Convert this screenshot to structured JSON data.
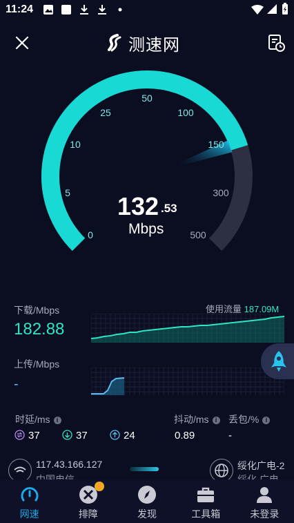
{
  "status_bar": {
    "time": "11:24"
  },
  "header": {
    "brand": "测速网"
  },
  "gauge": {
    "scale_labels": [
      "0",
      "5",
      "10",
      "25",
      "50",
      "100",
      "150",
      "300",
      "500"
    ],
    "speed_int": "132",
    "speed_dec": ".53",
    "unit": "Mbps",
    "progress_fraction": 0.77,
    "needle_value": 150
  },
  "download": {
    "title": "下载/Mbps",
    "value": "182.88"
  },
  "upload": {
    "title": "上传/Mbps",
    "value": "-"
  },
  "usage": {
    "label": "使用流量",
    "value": "187.09M"
  },
  "metrics": {
    "latency_title": "时延/ms",
    "idle": "37",
    "down": "37",
    "up": "24",
    "jitter_title": "抖动/ms",
    "jitter": "0.89",
    "loss_title": "丢包/%",
    "loss": "-"
  },
  "server": {
    "ip": "117.43.166.127",
    "isp": "中国电信",
    "node": "绥化广电-2",
    "city": "绥化 广电"
  },
  "nav": [
    {
      "label": "网速"
    },
    {
      "label": "排障"
    },
    {
      "label": "发现"
    },
    {
      "label": "工具箱"
    },
    {
      "label": "未登录"
    }
  ],
  "colors": {
    "accent": "#2ee6c6",
    "nav_active": "#1fa8e8",
    "background": "#0b0d20"
  }
}
